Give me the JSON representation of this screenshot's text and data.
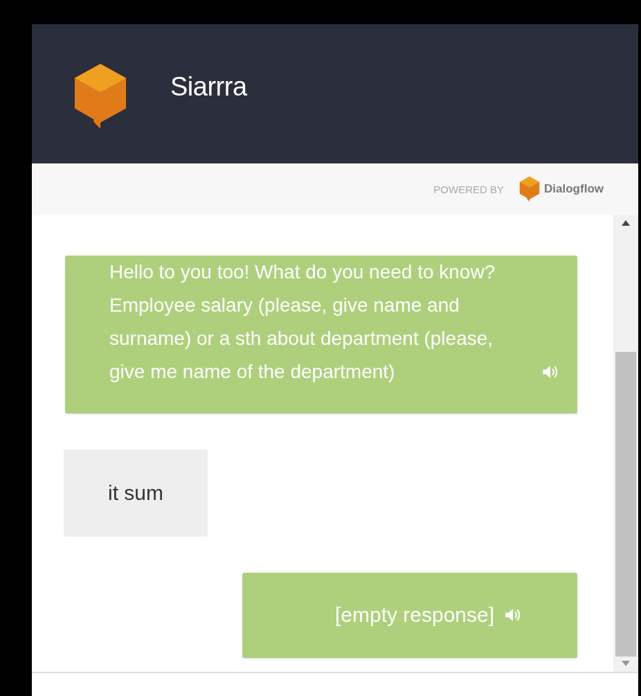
{
  "header": {
    "title": "Siarrra"
  },
  "powered_by": {
    "label": "POWERED BY",
    "brand": "Dialogflow"
  },
  "messages": [
    {
      "kind": "bot",
      "text": "Hello to you too! What do you need to know? Employee salary (please, give name and surname) or a sth about department (please, give me name of the department)",
      "audio": true
    },
    {
      "kind": "user",
      "text": "it sum",
      "audio": false
    },
    {
      "kind": "bot",
      "text": "[empty response]",
      "audio": true
    }
  ]
}
